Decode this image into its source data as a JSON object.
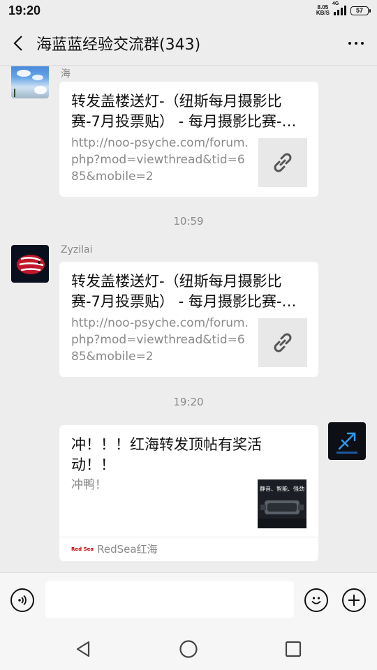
{
  "status_bar": {
    "time": "19:20",
    "net_speed_value": "8.05",
    "net_speed_unit": "KB/S",
    "network": "4G",
    "battery": "57"
  },
  "header": {
    "title": "海蓝蓝经验交流群(343)"
  },
  "messages": [
    {
      "sender": "海",
      "title": "转发盖楼送灯-（纽斯每月摄影比赛-7月投票贴） - 每月摄影比赛-…",
      "desc": "http://noo-psyche.com/forum.php?mod=viewthread&tid=685&mobile=2",
      "thumb_icon": "link-icon"
    },
    {
      "timestamp": "10:59"
    },
    {
      "sender": "Zyzilai",
      "title": "转发盖楼送灯-（纽斯每月摄影比赛-7月投票贴） - 每月摄影比赛-…",
      "desc": "http://noo-psyche.com/forum.php?mod=viewthread&tid=685&mobile=2",
      "thumb_icon": "link-icon"
    },
    {
      "timestamp": "19:20"
    },
    {
      "title": "冲！！！红海转发顶帖有奖活动！！",
      "desc": "冲鸭！",
      "thumb_text": "静音、智能、强劲",
      "source_logo": "Red Sea",
      "source": "RedSea红海"
    }
  ],
  "input": {
    "value": "",
    "voice_icon": "voice-icon",
    "emoji_icon": "emoji-icon",
    "add_icon": "plus-icon"
  },
  "nav": {
    "back_icon": "triangle-back-icon",
    "home_icon": "circle-home-icon",
    "recent_icon": "square-recents-icon"
  },
  "colors": {
    "background": "#ededed",
    "card": "#ffffff",
    "muted_text": "#8a8a8a",
    "link_thumb": "#e8e8e8"
  }
}
